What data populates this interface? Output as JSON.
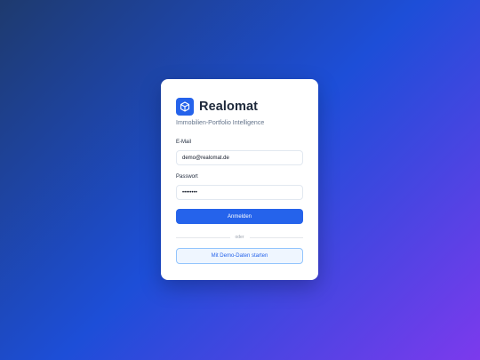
{
  "brand": {
    "name": "Realomat",
    "tagline": "Immobilien-Portfolio Intelligence",
    "logo_icon": "building-icon"
  },
  "form": {
    "email_label": "E-Mail",
    "email_value": "demo@realomat.de",
    "password_label": "Passwort",
    "password_value": "••••••••",
    "submit_label": "Anmelden",
    "divider_text": "oder",
    "demo_label": "Mit Demo-Daten starten"
  },
  "colors": {
    "accent": "#2563eb",
    "background_start": "#1e3a6e",
    "background_end": "#7c3aed"
  }
}
